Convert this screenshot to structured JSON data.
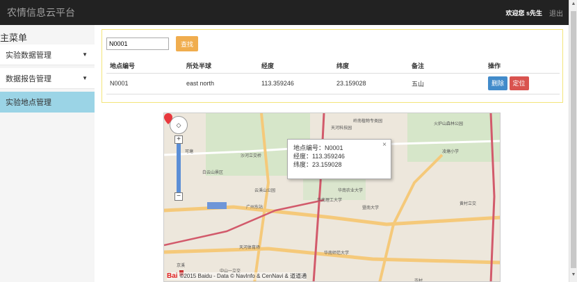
{
  "navbar": {
    "title": "农情信息云平台",
    "welcome": "欢迎您 s先生",
    "logout": "退出"
  },
  "sidebar": {
    "title": "主菜单",
    "items": [
      {
        "label": "实验数据管理"
      },
      {
        "label": "数据报告管理"
      },
      {
        "label": "实验地点管理"
      }
    ]
  },
  "search": {
    "value": "N0001",
    "button": "查找"
  },
  "table": {
    "headers": [
      "地点编号",
      "所处半球",
      "经度",
      "纬度",
      "备注",
      "操作"
    ],
    "row": {
      "id": "N0001",
      "hemisphere": "east north",
      "lng": "113.359246",
      "lat": "23.159028",
      "note": "五山"
    },
    "delete": "删除",
    "locate": "定位"
  },
  "map": {
    "info": {
      "id_line": "地点编号：N0001",
      "lng_line": "经度：113.359246",
      "lat_line": "纬度：23.159028"
    },
    "copyright": "©2015 Baidu - Data © NavInfo & CenNavi & 道道通",
    "labels": [
      "岭南植物专类园",
      "天河科技园",
      "华南农业大学",
      "华南理工大学",
      "暨南大学",
      "广州东站",
      "天河体育场",
      "沙河立交桥",
      "白云山景区",
      "中山一立交",
      "岑村",
      "华南师范大学",
      "凌塘小学",
      "云溪山公园",
      "黄村立交",
      "京溪",
      "可塘",
      "火炉山森林公园"
    ],
    "baidu": "Bai"
  }
}
